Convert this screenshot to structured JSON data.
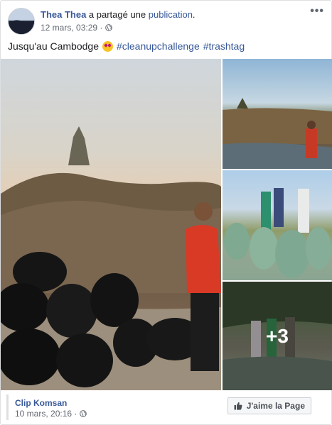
{
  "post": {
    "author": "Thea Thea",
    "shared_text": " a partagé une ",
    "publication_link": "publication",
    "period": ".",
    "timestamp": "12 mars, 03:29 ·",
    "more_icon": "more-horizontal-icon",
    "caption_text": "Jusqu'au Cambodge",
    "caption_emoji": "star-struck-emoji",
    "hashtags": [
      "#cleanupchallenge",
      "#trashtag"
    ]
  },
  "gallery": {
    "more_count": "+3"
  },
  "footer": {
    "page_name": "Clip Komsan",
    "timestamp": "10 mars, 20:16 ·",
    "like_page_label": "J'aime la Page"
  },
  "colors": {
    "link": "#385898",
    "meta": "#616770",
    "border": "#dddfe2"
  }
}
